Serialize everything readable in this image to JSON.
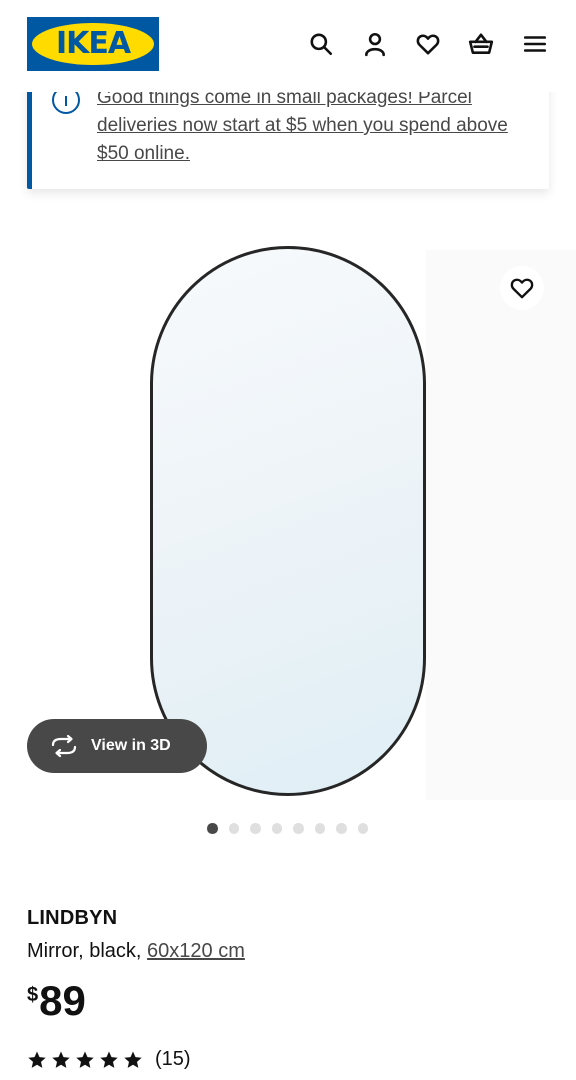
{
  "header": {
    "logo_text": "IKEA",
    "icons": [
      "search-icon",
      "account-icon",
      "heart-icon",
      "basket-icon",
      "menu-icon"
    ]
  },
  "banner": {
    "message": "Good things come in small packages! Parcel deliveries now start at $5 when you spend above $50 online.",
    "icon": "info-icon",
    "accent_color": "#0058a3"
  },
  "gallery": {
    "view_3d_label": "View in 3D",
    "image_count": 8,
    "active_index": 0
  },
  "product": {
    "name": "LINDBYN",
    "description": "Mirror, black,",
    "size": "60x120 cm",
    "currency": "$",
    "price": "89",
    "rating_stars": 5,
    "rating_count": "(15)"
  },
  "colors": {
    "brand_blue": "#0058a3",
    "brand_yellow": "#ffdb00",
    "text": "#111111",
    "pill_bg": "#484848"
  }
}
